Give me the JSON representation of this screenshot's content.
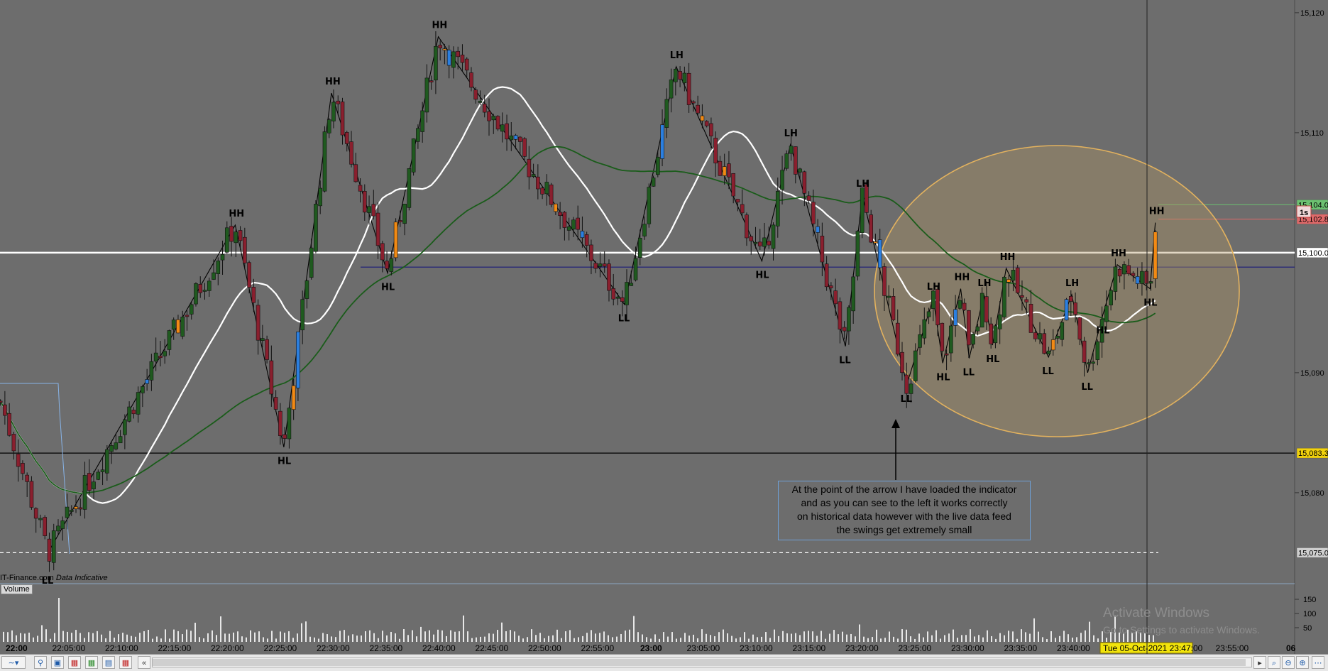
{
  "chart_data": {
    "type": "candlestick",
    "y_axis": {
      "ticks": [
        "15,120",
        "15,110",
        "15,090",
        "15,080"
      ],
      "range": [
        15071,
        15121
      ]
    },
    "price_tags": [
      {
        "label": "15,104.0",
        "price": 15104.0,
        "color": "#6cc070"
      },
      {
        "label": "15,102.8",
        "price": 15102.8,
        "color": "#e06a6a"
      },
      {
        "label": "15,100.0",
        "price": 15100.0,
        "color": "#ffffff"
      },
      {
        "label": "15,083.3",
        "price": 15083.3,
        "color": "#f2d20c"
      },
      {
        "label": "15,075.0",
        "price": 15075.0,
        "color": "#cfcfcf"
      }
    ],
    "timeframe_label": "1s",
    "x_axis": {
      "ticks": [
        "22:00",
        "22:05:00",
        "22:10:00",
        "22:15:00",
        "22:20:00",
        "22:25:00",
        "22:30:00",
        "22:35:00",
        "22:40:00",
        "22:45:00",
        "22:50:00",
        "22:55:00",
        "23:00",
        "23:05:00",
        "23:10:00",
        "23:15:00",
        "23:20:00",
        "23:25:00",
        "23:30:00",
        "23:35:00",
        "23:40:00",
        "23:55:00",
        "06"
      ],
      "cursor_label": "Tue 05-Oct-2021 23:47:00"
    },
    "horizontal_lines": [
      {
        "price": 15100.0,
        "color": "#ffffff",
        "style": "solid"
      },
      {
        "price": 15098.8,
        "color": "#1a1a7a",
        "style": "solid"
      },
      {
        "price": 15083.3,
        "color": "#000000",
        "style": "solid"
      },
      {
        "price": 15075.0,
        "color": "#ffffff",
        "style": "dashed"
      }
    ],
    "swing_points": [
      {
        "label": "LL",
        "time": 3.2,
        "price": 15075.0
      },
      {
        "label": "HH",
        "time": 20.9,
        "price": 15102.3
      },
      {
        "label": "HL",
        "time": 25.5,
        "price": 15083.8
      },
      {
        "label": "HH",
        "time": 30.0,
        "price": 15113.3
      },
      {
        "label": "HL",
        "time": 35.3,
        "price": 15098.3
      },
      {
        "label": "HH",
        "time": 40.1,
        "price": 15118.0
      },
      {
        "label": "LL",
        "time": 57.7,
        "price": 15095.7
      },
      {
        "label": "LH",
        "time": 62.6,
        "price": 15115.5
      },
      {
        "label": "HL",
        "time": 70.7,
        "price": 15099.3
      },
      {
        "label": "LH",
        "time": 73.4,
        "price": 15109.0
      },
      {
        "label": "LL",
        "time": 78.6,
        "price": 15092.2
      },
      {
        "label": "LH",
        "time": 80.2,
        "price": 15104.8
      },
      {
        "label": "LL",
        "time": 84.4,
        "price": 15089.0
      },
      {
        "label": "LH",
        "time": 86.9,
        "price": 15096.2
      },
      {
        "label": "HL",
        "time": 87.8,
        "price": 15090.8
      },
      {
        "label": "HH",
        "time": 89.5,
        "price": 15097.0
      },
      {
        "label": "LL",
        "time": 90.3,
        "price": 15091.2
      },
      {
        "label": "LH",
        "time": 91.7,
        "price": 15096.5
      },
      {
        "label": "HL",
        "time": 92.5,
        "price": 15092.3
      },
      {
        "label": "HH",
        "time": 93.8,
        "price": 15098.7
      },
      {
        "label": "LL",
        "time": 97.8,
        "price": 15091.3
      },
      {
        "label": "LH",
        "time": 100.0,
        "price": 15096.5
      },
      {
        "label": "LL",
        "time": 101.5,
        "price": 15090.0
      },
      {
        "label": "HL",
        "time": 102.9,
        "price": 15094.7
      },
      {
        "label": "HH",
        "time": 104.3,
        "price": 15099.0
      },
      {
        "label": "HL",
        "time": 107.4,
        "price": 15097.0
      },
      {
        "label": "HH",
        "time": 107.9,
        "price": 15102.5
      }
    ],
    "volume": {
      "axis_ticks": [
        "150",
        "100",
        "50"
      ]
    }
  },
  "annotation": {
    "lines": [
      "At the point of the arrow I have loaded the indicator",
      "and as you can see to the left it works correctly",
      "on historical data however with the live data feed",
      "the swings get extremely small"
    ]
  },
  "data_source": {
    "vendor": "IT-Finance.com",
    "note": "Data Indicative"
  },
  "volume_label": "Volume",
  "watermark": {
    "title": "Activate Windows",
    "subtitle": "Go to Settings to activate Windows."
  },
  "colors": {
    "background": "#6d6d6d",
    "bull": "#1f5a1f",
    "bear": "#8a1f2e",
    "highlight_blue": "#2b7fe0",
    "highlight_orange": "#f28a14",
    "ellipse": "#e3b25e",
    "sma_white": "#ffffff",
    "sma_green": "#1a5c1a"
  }
}
